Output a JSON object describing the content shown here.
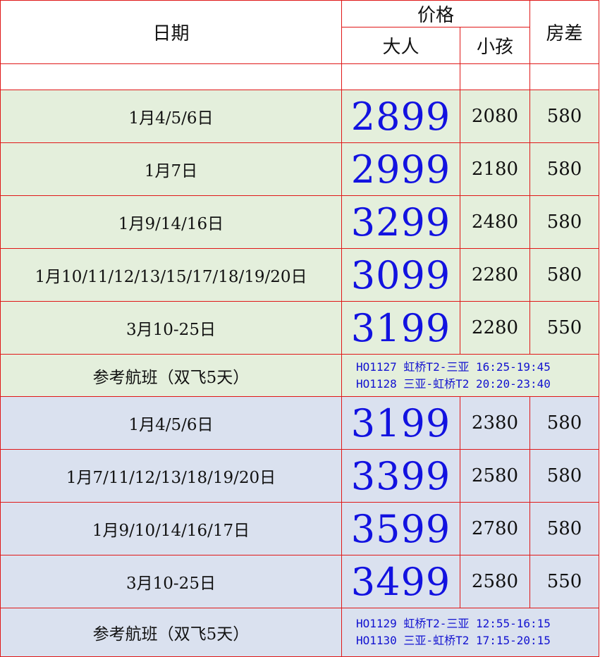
{
  "header": {
    "date": "日期",
    "price": "价格",
    "adult": "大人",
    "child": "小孩",
    "room_diff": "房差"
  },
  "group1": {
    "rows": [
      {
        "date": "1月4/5/6日",
        "adult": "2899",
        "child": "2080",
        "room": "580"
      },
      {
        "date": "1月7日",
        "adult": "2999",
        "child": "2180",
        "room": "580"
      },
      {
        "date": "1月9/14/16日",
        "adult": "3299",
        "child": "2480",
        "room": "580"
      },
      {
        "date": "1月10/11/12/13/15/17/18/19/20日",
        "adult": "3099",
        "child": "2280",
        "room": "580"
      },
      {
        "date": "3月10-25日",
        "adult": "3199",
        "child": "2280",
        "room": "550"
      }
    ],
    "flight_label": "参考航班（双飞5天）",
    "flights": [
      "HO1127 虹桥T2-三亚 16:25-19:45",
      "HO1128 三亚-虹桥T2 20:20-23:40"
    ]
  },
  "group2": {
    "rows": [
      {
        "date": "1月4/5/6日",
        "adult": "3199",
        "child": "2380",
        "room": "580"
      },
      {
        "date": "1月7/11/12/13/18/19/20日",
        "adult": "3399",
        "child": "2580",
        "room": "580"
      },
      {
        "date": "1月9/10/14/16/17日",
        "adult": "3599",
        "child": "2780",
        "room": "580"
      },
      {
        "date": "3月10-25日",
        "adult": "3499",
        "child": "2580",
        "room": "550"
      }
    ],
    "flight_label": "参考航班（双飞5天）",
    "flights": [
      "HO1129 虹桥T2-三亚 12:55-16:15",
      "HO1130 三亚-虹桥T2 17:15-20:15"
    ]
  },
  "colors": {
    "border": "#e01818",
    "adult_price": "#1212e0",
    "flight_text": "#1212d0",
    "group1_bg": "#e4efdc",
    "group2_bg": "#dae1ef"
  }
}
